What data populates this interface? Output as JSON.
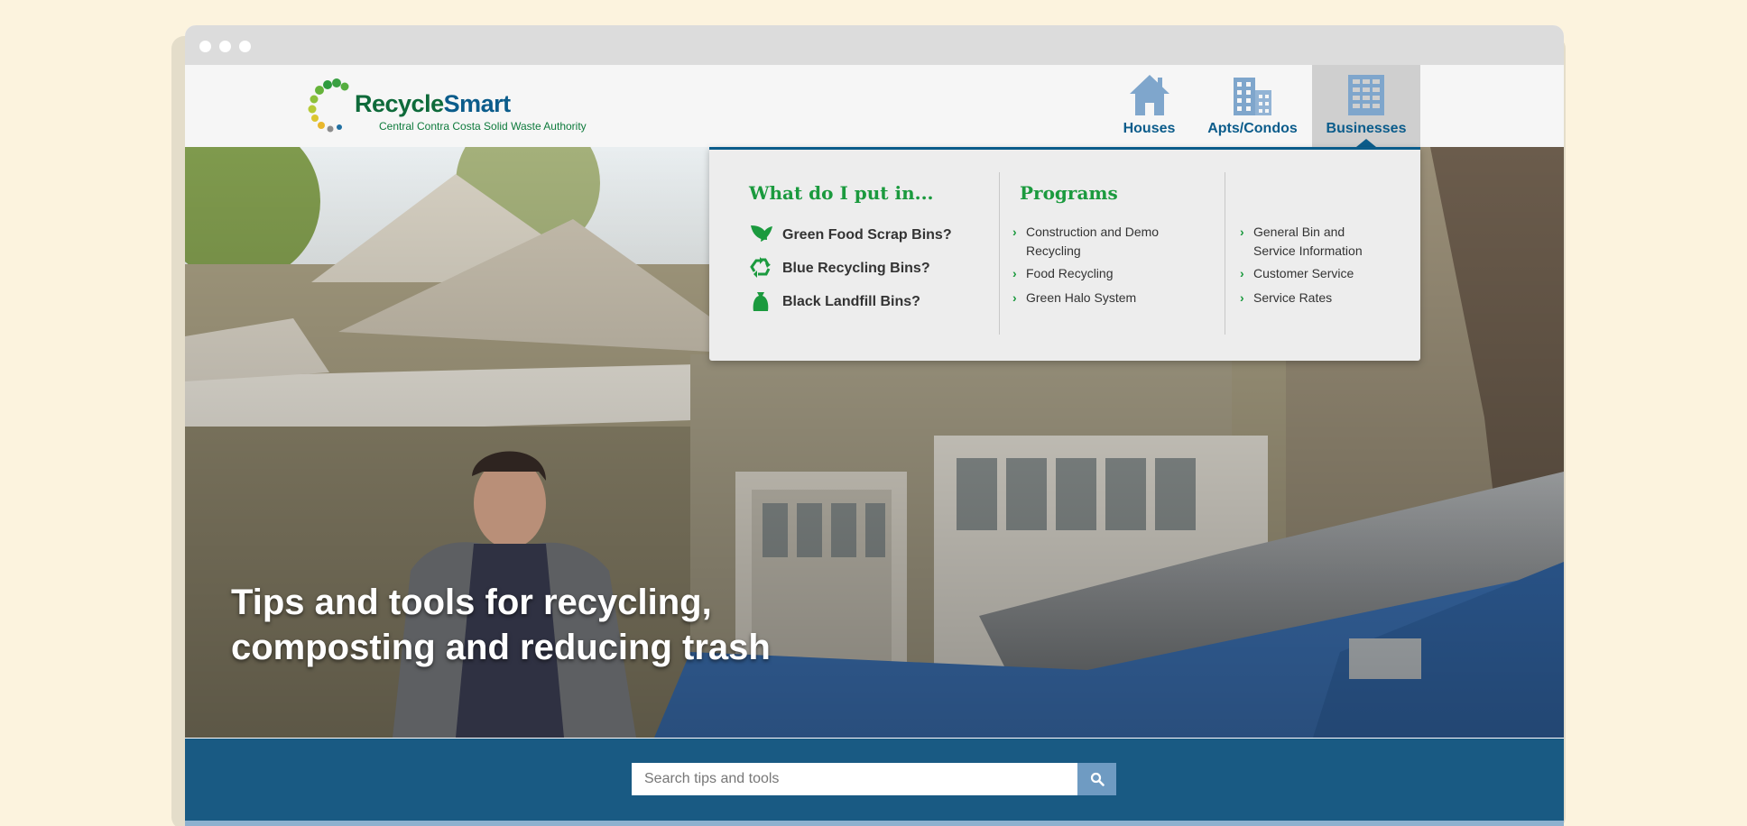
{
  "window": {
    "controls": [
      "dot",
      "dot",
      "dot"
    ]
  },
  "header": {
    "logo": {
      "title_a": "Recycle",
      "title_b": "Smart",
      "subtitle": "Central Contra Costa Solid Waste Authority"
    },
    "nav": [
      {
        "label": "Houses",
        "icon": "house-icon"
      },
      {
        "label": "Apts/Condos",
        "icon": "apartment-building-icon"
      },
      {
        "label": "Businesses",
        "icon": "office-building-icon",
        "active": true
      }
    ]
  },
  "menu": {
    "col1_heading": "What do I put in...",
    "bins": [
      {
        "label": "Green Food Scrap Bins?",
        "icon": "leaf-icon"
      },
      {
        "label": "Blue Recycling Bins?",
        "icon": "recycle-icon"
      },
      {
        "label": "Black Landfill Bins?",
        "icon": "landfill-bag-icon"
      }
    ],
    "col2_heading": "Programs",
    "programs": [
      {
        "label": "Construction and Demo Recycling"
      },
      {
        "label": "Food Recycling"
      },
      {
        "label": "Green Halo System"
      }
    ],
    "col3_links": [
      {
        "label": "General Bin and Service Information"
      },
      {
        "label": "Customer Service"
      },
      {
        "label": "Service Rates"
      }
    ]
  },
  "hero": {
    "headline": "Tips and tools for recycling, composting and reducing trash"
  },
  "search": {
    "placeholder": "Search tips and tools",
    "button_icon": "search-icon"
  },
  "colors": {
    "brand_blue": "#0b5c8b",
    "brand_green": "#1b9a3e",
    "nav_active_bg": "#cfcfcf",
    "search_band": "#084d7a",
    "search_button": "#6f9bc2",
    "page_background": "#fcf3de"
  }
}
